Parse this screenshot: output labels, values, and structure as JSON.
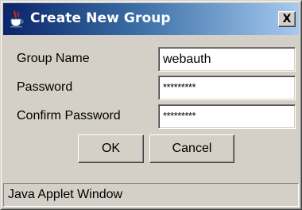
{
  "window": {
    "title": "Create New Group",
    "app_icon": "java-coffee-cup-icon",
    "close_icon": "close-icon",
    "close_label": "X",
    "titlebar_color": "#0a246a",
    "face_color": "#d4d0c8"
  },
  "form": {
    "group_name_label": "Group Name",
    "group_name_value": "webauth",
    "password_label": "Password",
    "password_value": "*********",
    "confirm_password_label": "Confirm Password",
    "confirm_password_value": "*********"
  },
  "buttons": {
    "ok_label": "OK",
    "cancel_label": "Cancel"
  },
  "status_bar": {
    "text": "Java Applet Window"
  }
}
